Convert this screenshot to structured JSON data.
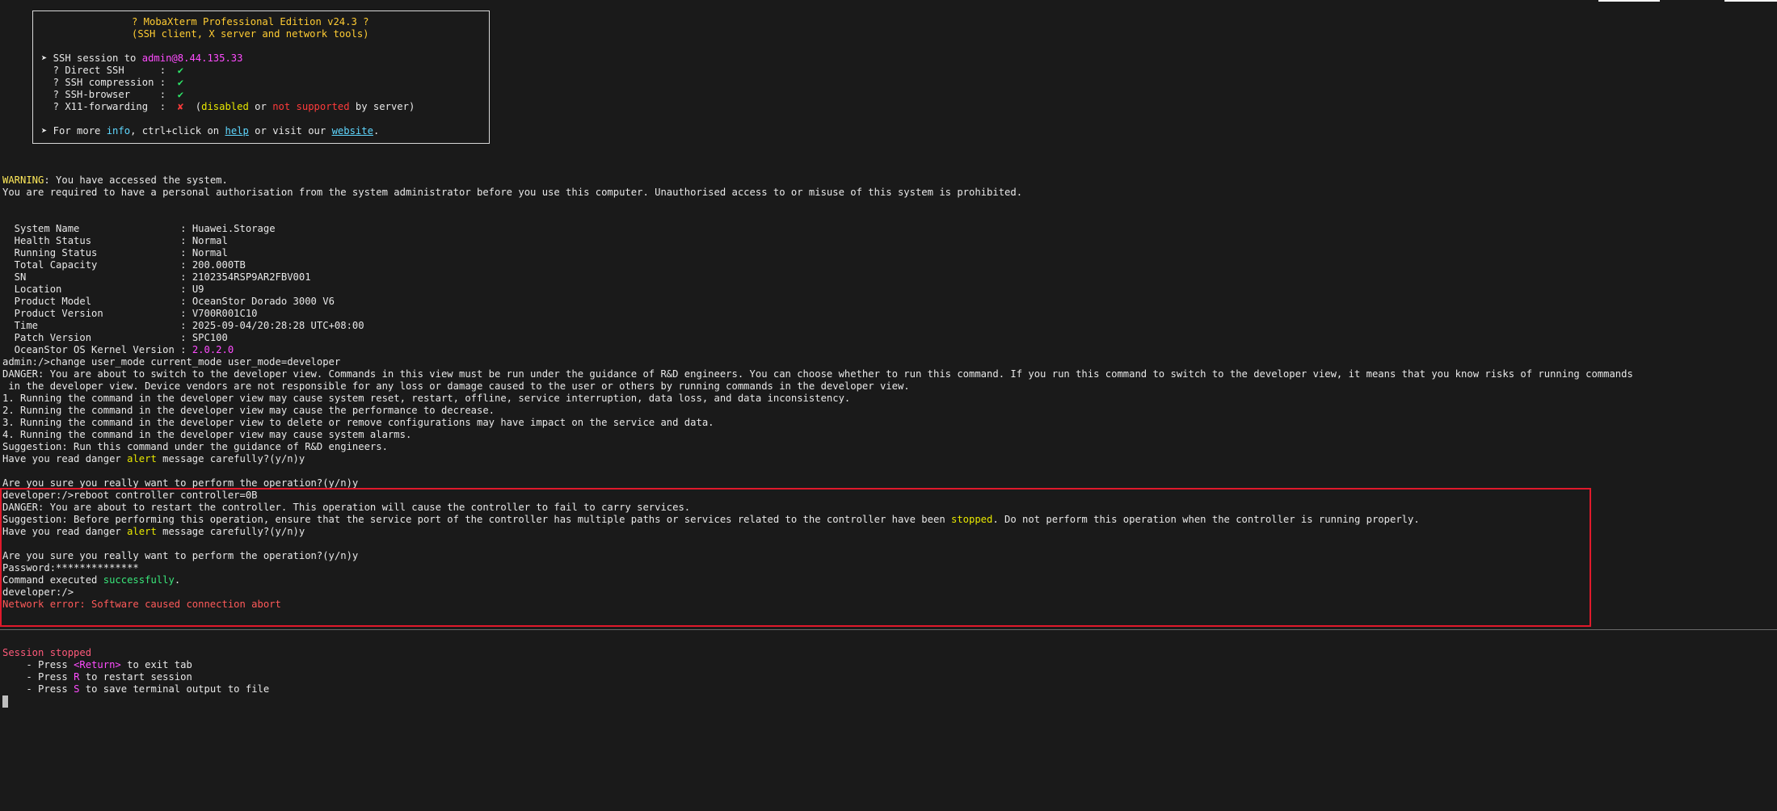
{
  "banner": {
    "title": "? MobaXterm Professional Edition v24.3 ?",
    "subtitle": "(SSH client, X server and network tools)",
    "ssh_session_prefix": "➤ SSH session to ",
    "ssh_session_target": "admin@8.44.135.33",
    "direct_ssh_label": "  ? Direct SSH      :  ",
    "check": "✔",
    "cross": "✘",
    "ssh_compression_label": "  ? SSH compression :  ",
    "ssh_browser_label": "  ? SSH-browser     :  ",
    "x11_label": "  ? X11-forwarding  :  ",
    "x11_open": "  (",
    "x11_disabled": "disabled",
    "x11_or": " or ",
    "x11_not_supported": "not supported",
    "x11_by_server": " by server)",
    "more_prefix": "➤ For more ",
    "more_info": "info",
    "more_mid": ", ctrl+click on ",
    "more_help": "help",
    "more_visit": " or visit our ",
    "more_website": "website",
    "more_end": "."
  },
  "warning": {
    "label": "WARNING",
    "text": ": You have accessed the system.",
    "line2": "You are required to have a personal authorisation from the system administrator before you use this computer. Unauthorised access to or misuse of this system is prohibited."
  },
  "system_info": [
    {
      "label": "  System Name                 : ",
      "value": "Huawei.Storage"
    },
    {
      "label": "  Health Status               : ",
      "value": "Normal"
    },
    {
      "label": "  Running Status              : ",
      "value": "Normal"
    },
    {
      "label": "  Total Capacity              : ",
      "value": "200.000TB"
    },
    {
      "label": "  SN                          : ",
      "value": "2102354RSP9AR2FBV001"
    },
    {
      "label": "  Location                    : ",
      "value": "U9"
    },
    {
      "label": "  Product Model               : ",
      "value": "OceanStor Dorado 3000 V6"
    },
    {
      "label": "  Product Version             : ",
      "value": "V700R001C10"
    },
    {
      "label": "  Time                        : ",
      "value": "2025-09-04/20:28:28 UTC+08:00"
    },
    {
      "label": "  Patch Version               : ",
      "value": "SPC100"
    },
    {
      "label": "  OceanStor OS Kernel Version : ",
      "value": "2.0.2.0"
    }
  ],
  "session": {
    "cmd1": "admin:/>change user_mode current_mode user_mode=developer",
    "danger1a": "DANGER: You are about to switch to the developer view. Commands in this view must be run under the guidance of R&D engineers. You can choose whether to run this command. If you run this command to switch to the developer view, it means that you know risks of running commands",
    "danger1b": " in the developer view. Device vendors are not responsible for any loss or damage caused to the user or others by running commands in the developer view.",
    "risk1": "1. Running the command in the developer view may cause system reset, restart, offline, service interruption, data loss, and data inconsistency.",
    "risk2": "2. Running the command in the developer view may cause the performance to decrease.",
    "risk3": "3. Running the command in the developer view to delete or remove configurations may have impact on the service and data.",
    "risk4": "4. Running the command in the developer view may cause system alarms.",
    "suggestion1": "Suggestion: Run this command under the guidance of R&D engineers.",
    "read_prefix": "Have you read danger ",
    "read_alert": "alert",
    "read_suffix": " message carefully?(y/n)y",
    "sure": "Are you sure you really want to perform the operation?(y/n)y",
    "cmd2": "developer:/>reboot controller controller=0B",
    "danger2": "DANGER: You are about to restart the controller. This operation will cause the controller to fail to carry services.",
    "suggestion2_prefix": "Suggestion: Before performing this operation, ensure that the service port of the controller has multiple paths or services related to the controller have been ",
    "suggestion2_stopped": "stopped",
    "suggestion2_suffix": ". Do not perform this operation when the controller is running properly.",
    "password": "Password:**************",
    "cmd_exec_prefix": "Command executed ",
    "cmd_exec_success": "successfully",
    "cmd_exec_suffix": ".",
    "prompt": "developer:/>",
    "network_error": "Network error: Software caused connection abort"
  },
  "stopped": {
    "title": "Session stopped",
    "line1_prefix": "    - Press ",
    "line1_key": "<Return>",
    "line1_suffix": " to exit tab",
    "line2_prefix": "    - Press ",
    "line2_key": "R",
    "line2_suffix": " to restart session",
    "line3_prefix": "    - Press ",
    "line3_key": "S",
    "line3_suffix": " to save terminal output to file"
  }
}
